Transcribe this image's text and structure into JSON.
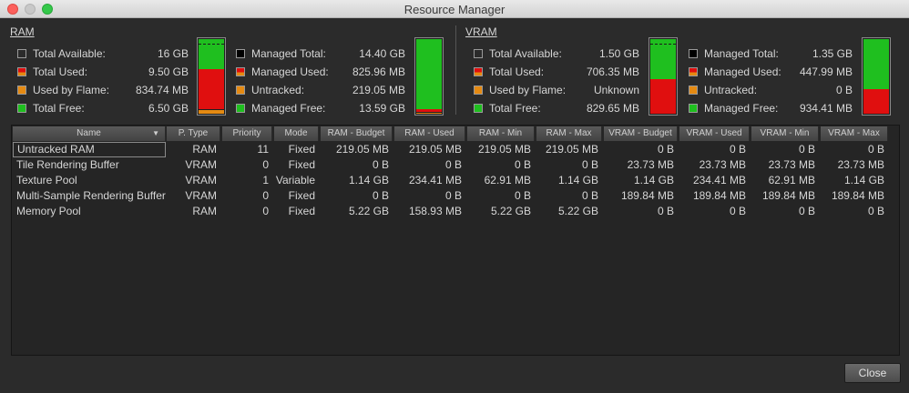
{
  "window": {
    "title": "Resource Manager"
  },
  "colors": {
    "green": "#1fbf1f",
    "red": "#e00f0f",
    "orange": "#e58a12",
    "black": "#000000"
  },
  "ram": {
    "title": "RAM",
    "total_available": {
      "label": "Total Available:",
      "value": "16 GB"
    },
    "total_used": {
      "label": "Total Used:",
      "value": "9.50 GB"
    },
    "used_by_flame": {
      "label": "Used by Flame:",
      "value": "834.74 MB"
    },
    "total_free": {
      "label": "Total Free:",
      "value": "6.50 GB"
    },
    "managed_total": {
      "label": "Managed Total:",
      "value": "14.40 GB"
    },
    "managed_used": {
      "label": "Managed Used:",
      "value": "825.96 MB"
    },
    "untracked": {
      "label": "Untracked:",
      "value": "219.05 MB"
    },
    "managed_free": {
      "label": "Managed Free:",
      "value": "13.59 GB"
    }
  },
  "vram": {
    "title": "VRAM",
    "total_available": {
      "label": "Total Available:",
      "value": "1.50 GB"
    },
    "total_used": {
      "label": "Total Used:",
      "value": "706.35 MB"
    },
    "used_by_flame": {
      "label": "Used by Flame:",
      "value": "Unknown"
    },
    "total_free": {
      "label": "Total Free:",
      "value": "829.65 MB"
    },
    "managed_total": {
      "label": "Managed Total:",
      "value": "1.35 GB"
    },
    "managed_used": {
      "label": "Managed Used:",
      "value": "447.99 MB"
    },
    "untracked": {
      "label": "Untracked:",
      "value": "0 B"
    },
    "managed_free": {
      "label": "Managed Free:",
      "value": "934.41 MB"
    }
  },
  "bars": {
    "ram_system": {
      "used_fraction": 0.594,
      "flame_fraction": 0.052
    },
    "ram_managed": {
      "used_fraction": 0.056,
      "untracked_fraction": 0.015
    },
    "vram_system": {
      "used_fraction": 0.46
    },
    "vram_managed": {
      "used_fraction": 0.324
    }
  },
  "table": {
    "columns": [
      "Name",
      "P. Type",
      "Priority",
      "Mode",
      "RAM - Budget",
      "RAM - Used",
      "RAM - Min",
      "RAM - Max",
      "VRAM - Budget",
      "VRAM - Used",
      "VRAM - Min",
      "VRAM - Max"
    ],
    "rows": [
      [
        "Untracked RAM",
        "RAM",
        "11",
        "Fixed",
        "219.05 MB",
        "219.05 MB",
        "219.05 MB",
        "219.05 MB",
        "0 B",
        "0 B",
        "0 B",
        "0 B"
      ],
      [
        "Tile Rendering Buffer",
        "VRAM",
        "0",
        "Fixed",
        "0 B",
        "0 B",
        "0 B",
        "0 B",
        "23.73 MB",
        "23.73 MB",
        "23.73 MB",
        "23.73 MB"
      ],
      [
        "Texture Pool",
        "VRAM",
        "1",
        "Variable",
        "1.14 GB",
        "234.41 MB",
        "62.91 MB",
        "1.14 GB",
        "1.14 GB",
        "234.41 MB",
        "62.91 MB",
        "1.14 GB"
      ],
      [
        "Multi-Sample Rendering Buffer",
        "VRAM",
        "0",
        "Fixed",
        "0 B",
        "0 B",
        "0 B",
        "0 B",
        "189.84 MB",
        "189.84 MB",
        "189.84 MB",
        "189.84 MB"
      ],
      [
        "Memory Pool",
        "RAM",
        "0",
        "Fixed",
        "5.22 GB",
        "158.93 MB",
        "5.22 GB",
        "5.22 GB",
        "0 B",
        "0 B",
        "0 B",
        "0 B"
      ]
    ]
  },
  "buttons": {
    "close_label": "Close"
  }
}
